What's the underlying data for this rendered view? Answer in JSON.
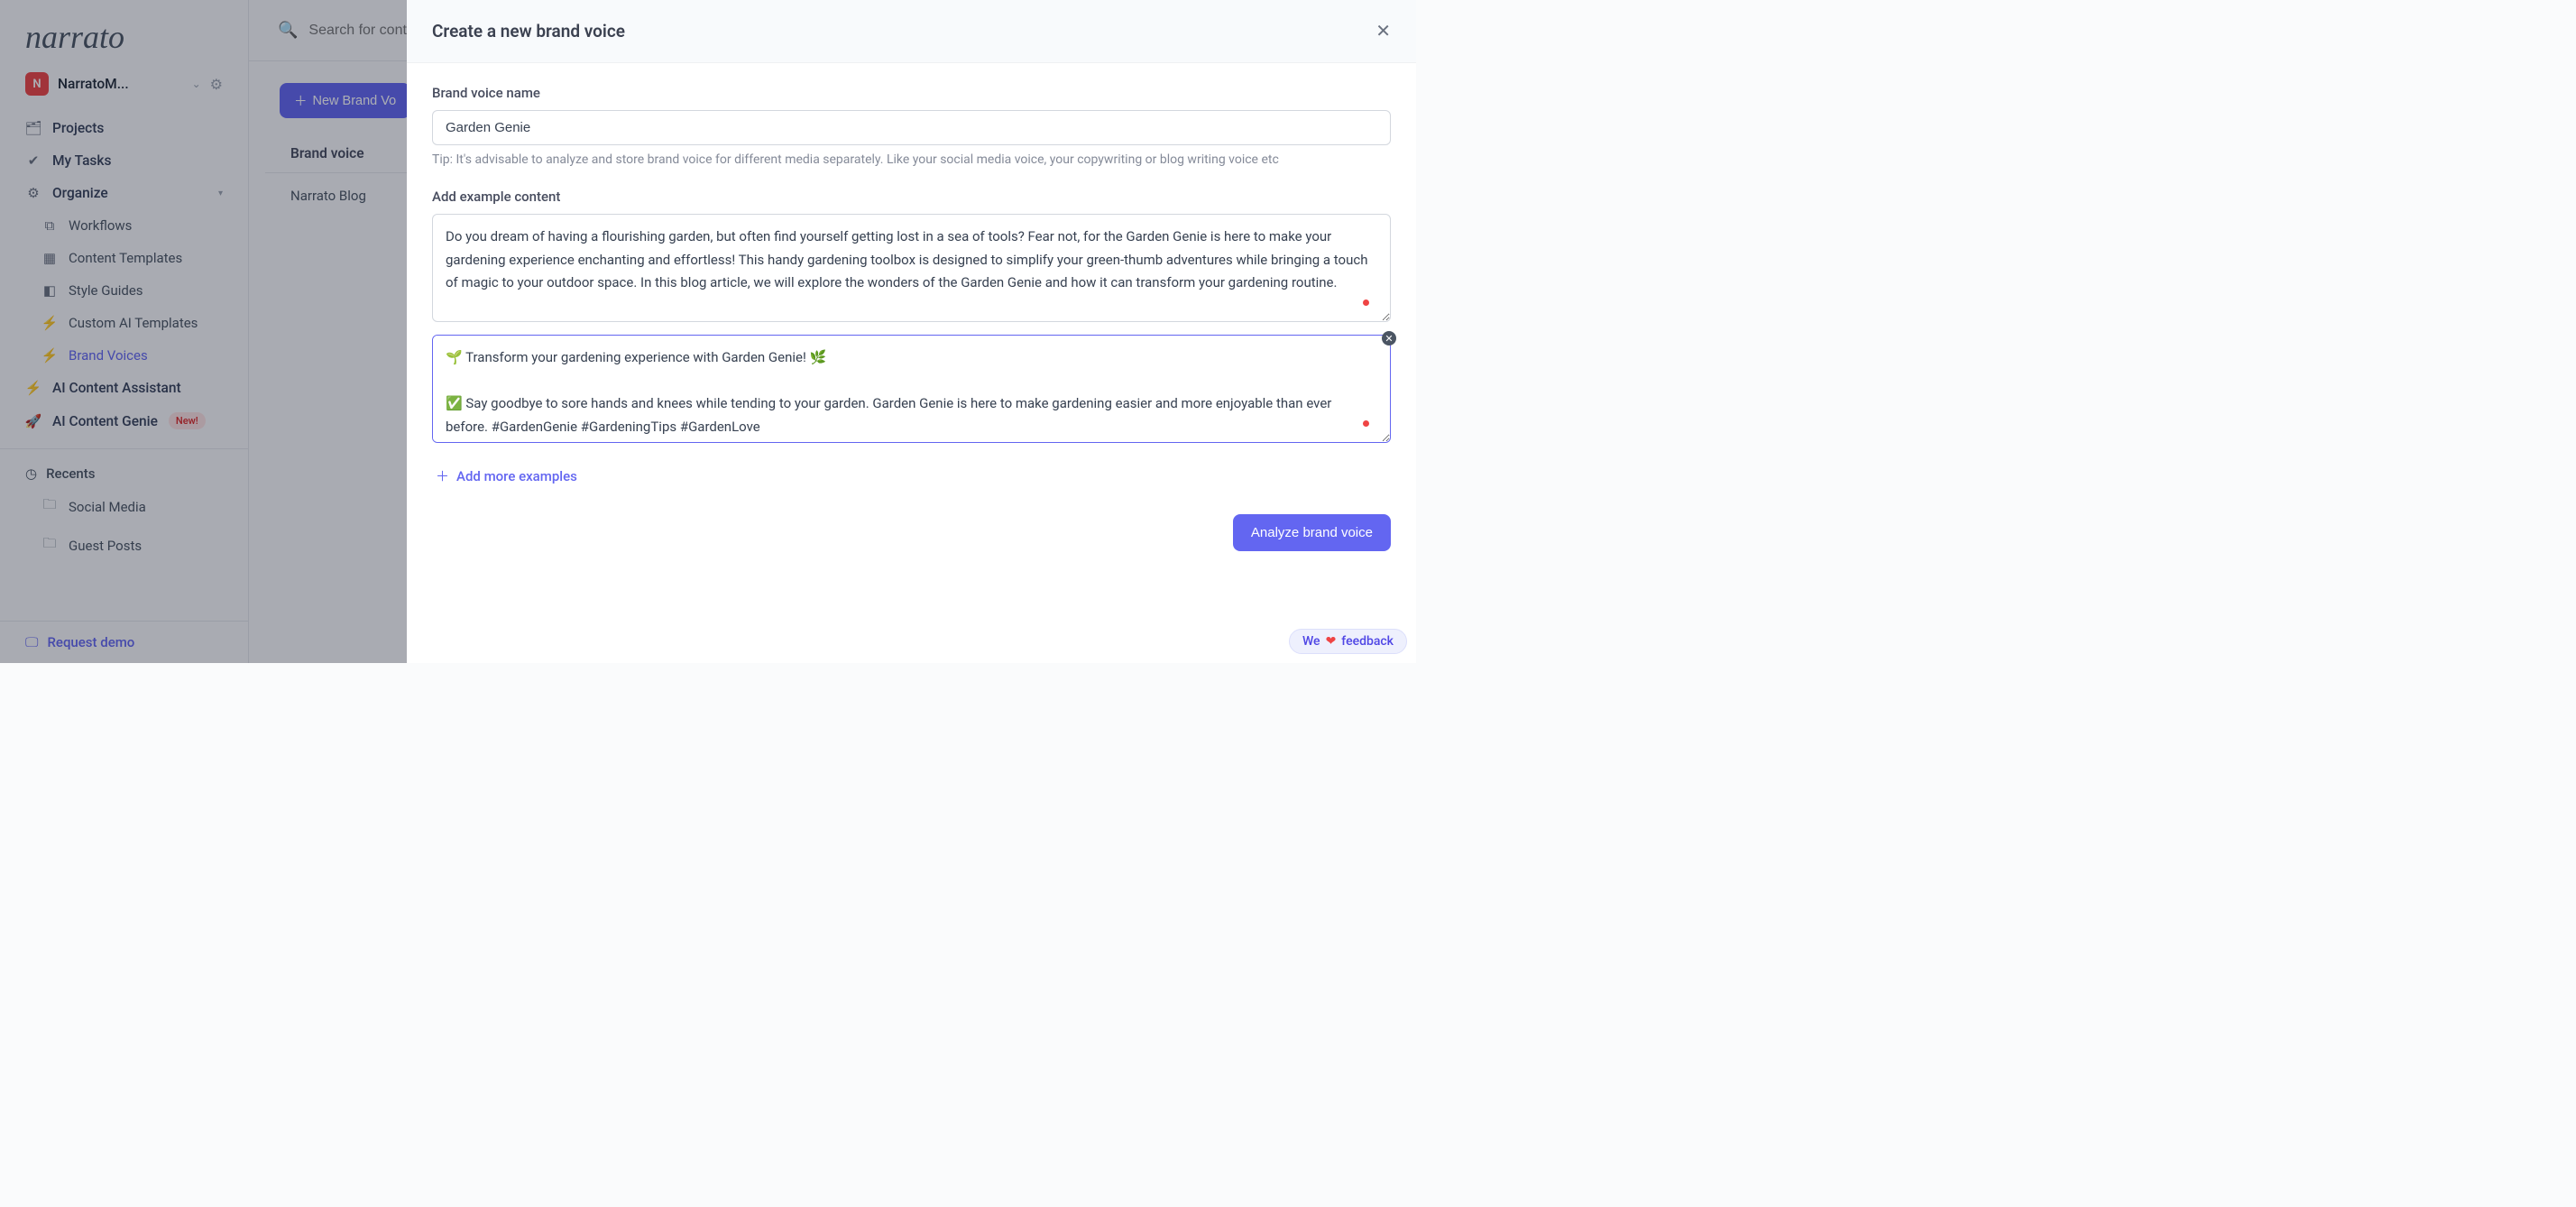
{
  "brand": {
    "logo_text": "narrato"
  },
  "workspace": {
    "badge": "N",
    "name": "NarratoM..."
  },
  "search": {
    "placeholder": "Search for cont"
  },
  "sidebar": {
    "projects": "Projects",
    "my_tasks": "My Tasks",
    "organize": "Organize",
    "workflows": "Workflows",
    "content_templates": "Content Templates",
    "style_guides": "Style Guides",
    "custom_ai_templates": "Custom AI Templates",
    "brand_voices": "Brand Voices",
    "ai_content_assistant": "AI Content Assistant",
    "ai_content_genie": "AI Content Genie",
    "badge_new": "New!",
    "recents": "Recents",
    "recent_items": [
      "Social Media",
      "Guest Posts"
    ],
    "request_demo": "Request demo"
  },
  "main": {
    "new_brand_voice_btn": "New Brand Vo",
    "col_header": "Brand voice",
    "rows": [
      "Narrato Blog"
    ]
  },
  "modal": {
    "title": "Create a new brand voice",
    "name_label": "Brand voice name",
    "name_value": "Garden Genie",
    "tip": "Tip: It's advisable to analyze and store brand voice for different media separately. Like your social media voice, your copywriting or blog writing voice etc",
    "example_label": "Add example content",
    "example1": "Do you dream of having a flourishing garden, but often find yourself getting lost in a sea of tools? Fear not, for the Garden Genie is here to make your gardening experience enchanting and effortless! This handy gardening toolbox is designed to simplify your green-thumb adventures while bringing a touch of magic to your outdoor space. In this blog article, we will explore the wonders of the Garden Genie and how it can transform your gardening routine.",
    "example2": "🌱 Transform your gardening experience with Garden Genie! 🌿\n\n✅ Say goodbye to sore hands and knees while tending to your garden. Garden Genie is here to make gardening easier and more enjoyable than ever before. #GardenGenie #GardeningTips #GardenLove",
    "add_more": "Add more examples",
    "analyze_btn": "Analyze brand voice"
  },
  "feedback": {
    "we": "We",
    "text": "feedback"
  }
}
